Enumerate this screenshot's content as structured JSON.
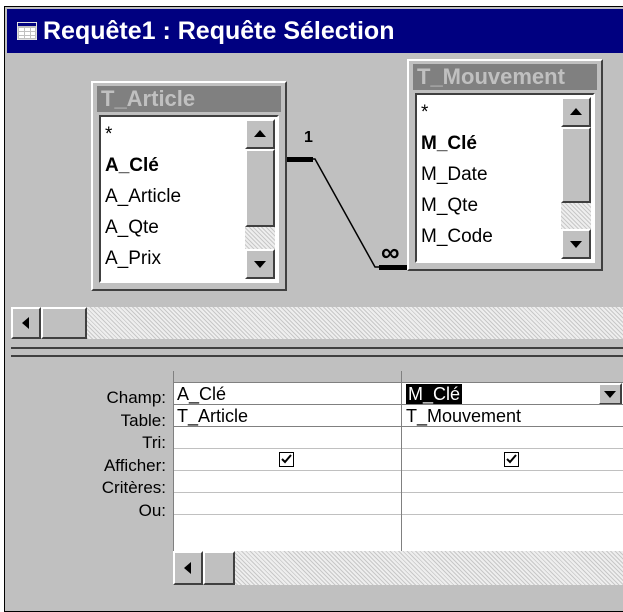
{
  "window": {
    "title": "Requête1 : Requête Sélection"
  },
  "tables": [
    {
      "name": "T_Article",
      "fields": [
        "*",
        "A_Clé",
        "A_Article",
        "A_Qte",
        "A_Prix"
      ],
      "key": "A_Clé"
    },
    {
      "name": "T_Mouvement",
      "fields": [
        "*",
        "M_Clé",
        "M_Date",
        "M_Qte",
        "M_Code"
      ],
      "key": "M_Clé"
    }
  ],
  "relationship": {
    "one_side": "1",
    "many_side": "∞"
  },
  "grid": {
    "row_labels": [
      "Champ:",
      "Table:",
      "Tri:",
      "Afficher:",
      "Critères:",
      "Ou:"
    ],
    "columns": [
      {
        "champ": "A_Clé",
        "table": "T_Article",
        "tri": "",
        "afficher": true,
        "criteres": "",
        "ou": ""
      },
      {
        "champ": "M_Clé",
        "table": "T_Mouvement",
        "tri": "",
        "afficher": true,
        "criteres": "",
        "ou": ""
      }
    ]
  },
  "icons": {
    "title": "query-window-icon",
    "scroll_up": "arrow-up-icon",
    "scroll_down": "arrow-down-icon",
    "scroll_left": "arrow-left-icon",
    "dropdown": "chevron-down-icon"
  },
  "colors": {
    "titlebar": "#000080",
    "window": "#c0c0c0",
    "inactive_caption": "#808080"
  }
}
